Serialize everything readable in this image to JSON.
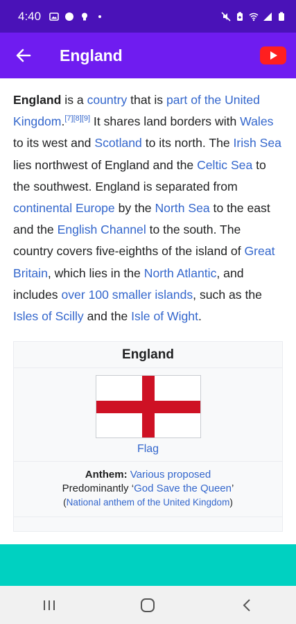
{
  "status_bar": {
    "time": "4:40",
    "left_icons": [
      "image-icon",
      "circle-icon",
      "bulb-icon",
      "dot-icon"
    ],
    "right_icons": [
      "mute-icon",
      "battery-saver-icon",
      "wifi-icon",
      "signal-icon",
      "battery-icon"
    ]
  },
  "app_bar": {
    "title": "England",
    "back_icon": "back-arrow-icon",
    "video_icon": "youtube-play-icon",
    "colors": {
      "status": "#4a12b8",
      "bar": "#6f1cf0"
    }
  },
  "article": {
    "t1": "England",
    "t2": " is a ",
    "l_country": "country",
    "t3": " that is ",
    "l_part": "part of the United Kingdom",
    "t4": ".",
    "ref": "[7][8][9]",
    "t5": " It shares land borders with ",
    "l_wales": "Wales",
    "t6": " to its west and ",
    "l_scotland": "Scotland",
    "t7": " to its north. The ",
    "l_irish": "Irish Sea",
    "t8": " lies northwest of England and the ",
    "l_celtic": "Celtic Sea",
    "t9": " to the southwest. England is separated from ",
    "l_europe": "continental Europe",
    "t10": " by the ",
    "l_north": "North Sea",
    "t11": " to the east and the ",
    "l_channel": "English Channel",
    "t12": " to the south. The country covers five-eighths of the island of ",
    "l_gb": "Great Britain",
    "t13": ", which lies in the ",
    "l_atlantic": "North Atlantic",
    "t14": ", and includes ",
    "l_islands": "over 100 smaller islands",
    "t15": ", such as the ",
    "l_scilly": "Isles of Scilly",
    "t16": " and the ",
    "l_wight": "Isle of Wight",
    "t17": "."
  },
  "infobox": {
    "title": "England",
    "flag_caption": "Flag",
    "anthem_label": "Anthem:",
    "anthem_link": "Various proposed",
    "predominantly": "Predominantly ",
    "god_save": "God Save the Queen",
    "national_anthem": "National anthem of the United Kingdom"
  },
  "colors": {
    "link": "#3366cc",
    "banner": "#00d1c1"
  }
}
